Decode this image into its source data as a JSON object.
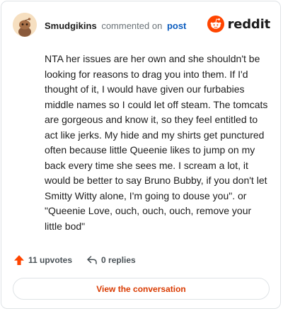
{
  "comment": {
    "username": "Smudgikins",
    "action_text": "commented on",
    "post_link": "post",
    "body": "NTA her issues are her own and she shouldn't be looking for reasons to drag you into them. If I'd thought of it, I would have given our furbabies middle names so I could let off steam. The tomcats are gorgeous and know it, so they feel entitled to act like jerks. My hide and my shirts get punctured often because little Queenie likes to jump on my back every time she sees me. I scream a lot, it would be better to say Bruno Bubby, if you don't let Smitty Witty alone, I'm going to douse you\". or \"Queenie Love, ouch, ouch, ouch, remove your little bod\""
  },
  "brand": {
    "name": "reddit",
    "icon": "reddit-logo-icon",
    "color": "#ff4500"
  },
  "actions": {
    "upvotes": "11 upvotes",
    "replies": "0 replies",
    "upvote_color": "#ff4500"
  },
  "cta": {
    "label": "View the conversation",
    "color": "#d93a00"
  }
}
